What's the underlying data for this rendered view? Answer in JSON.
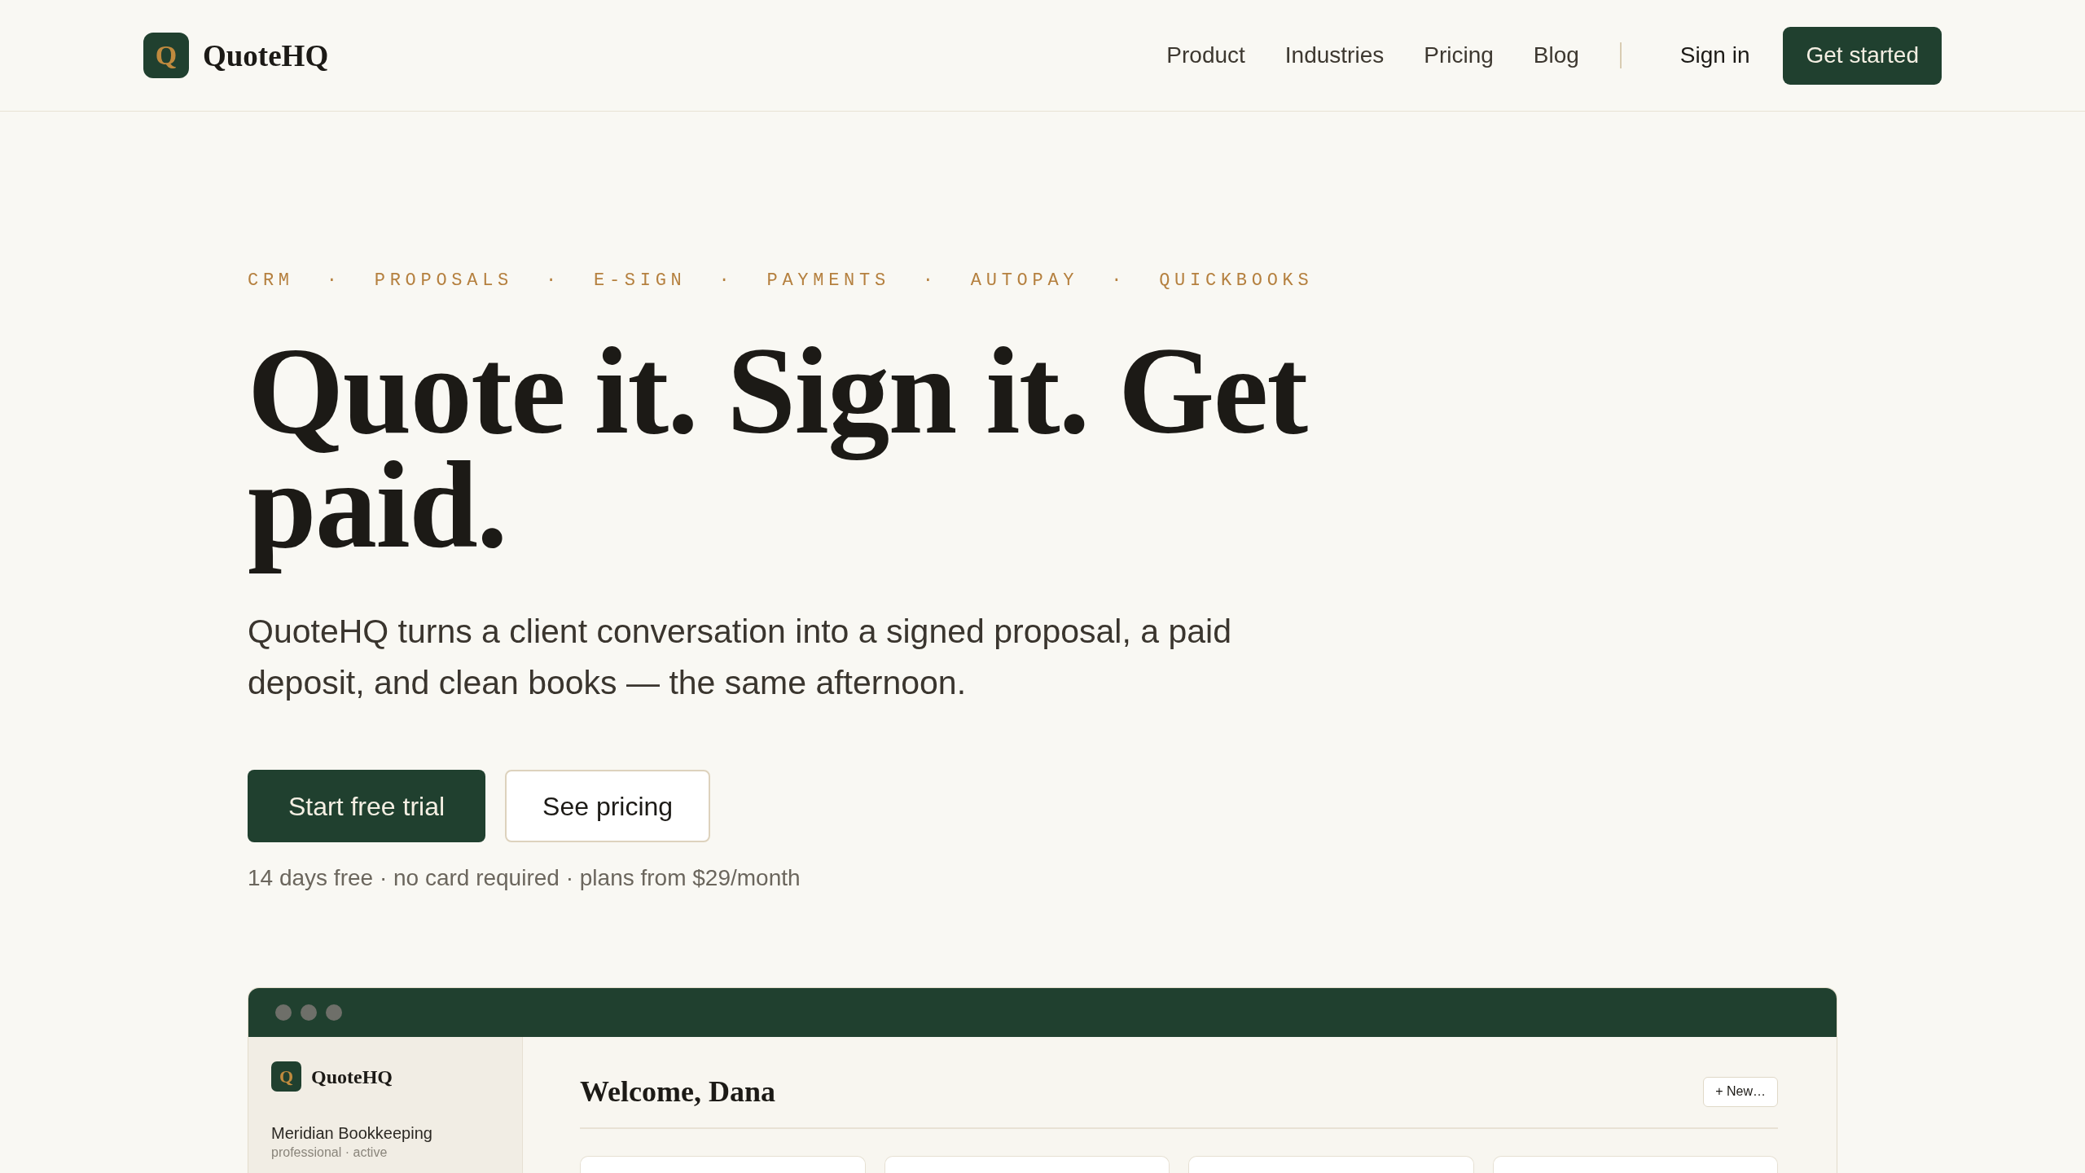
{
  "header": {
    "logo": {
      "mark": "Q",
      "name": "QuoteHQ"
    },
    "nav": [
      "Product",
      "Industries",
      "Pricing",
      "Blog"
    ],
    "sign_in": "Sign in",
    "cta": "Get started"
  },
  "hero": {
    "eyebrow": {
      "items": [
        "CRM",
        "PROPOSALS",
        "E-SIGN",
        "PAYMENTS",
        "AUTOPAY",
        "QUICKBOOKS"
      ],
      "separator": "·"
    },
    "headline": "Quote it. Sign it. Get paid.",
    "description": "QuoteHQ turns a client conversation into a signed proposal, a paid deposit, and clean books — the same afternoon.",
    "primary_button": "Start free trial",
    "secondary_button": "See pricing",
    "note": "14 days free · no card required · plans from $29/month"
  },
  "app_preview": {
    "sidebar": {
      "logo": {
        "mark": "Q",
        "name": "QuoteHQ"
      },
      "workspace": "Meridian Bookkeeping",
      "workspace_meta": "professional · active"
    },
    "main": {
      "title": "Welcome, Dana",
      "new_button": "+ New…"
    }
  }
}
